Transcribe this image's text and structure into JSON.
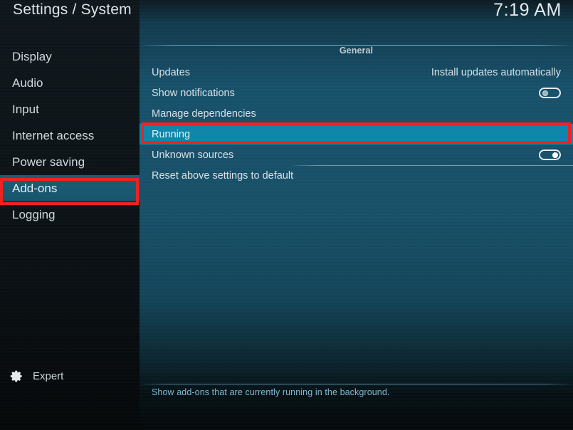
{
  "header": {
    "title": "Settings / System",
    "clock": "7:19 AM"
  },
  "sidebar": {
    "items": [
      {
        "label": "Display",
        "selected": false
      },
      {
        "label": "Audio",
        "selected": false
      },
      {
        "label": "Input",
        "selected": false
      },
      {
        "label": "Internet access",
        "selected": false
      },
      {
        "label": "Power saving",
        "selected": false
      },
      {
        "label": "Add-ons",
        "selected": true
      },
      {
        "label": "Logging",
        "selected": false
      }
    ],
    "level": {
      "icon": "gear-icon",
      "label": "Expert"
    }
  },
  "content": {
    "group_title": "General",
    "rows": [
      {
        "label": "Updates",
        "type": "value",
        "value": "Install updates automatically",
        "selected": false
      },
      {
        "label": "Show notifications",
        "type": "toggle",
        "toggle": "off",
        "selected": false
      },
      {
        "label": "Manage dependencies",
        "type": "plain",
        "selected": false
      },
      {
        "label": "Running",
        "type": "plain",
        "selected": true
      },
      {
        "label": "Unknown sources",
        "type": "toggle",
        "toggle": "on",
        "selected": false
      },
      {
        "label": "Reset above settings to default",
        "type": "plain",
        "selected": false
      }
    ],
    "description": "Show add-ons that are currently running in the background."
  },
  "annotations": {
    "color": "#ee2222",
    "targets": [
      "Add-ons",
      "Running"
    ]
  },
  "colors": {
    "selection": "#0f86aa",
    "sidebar_selection": "#17556c",
    "panel_top": "#17506a",
    "description_text": "#7fb9cf",
    "annotation_red": "#ee2222"
  }
}
